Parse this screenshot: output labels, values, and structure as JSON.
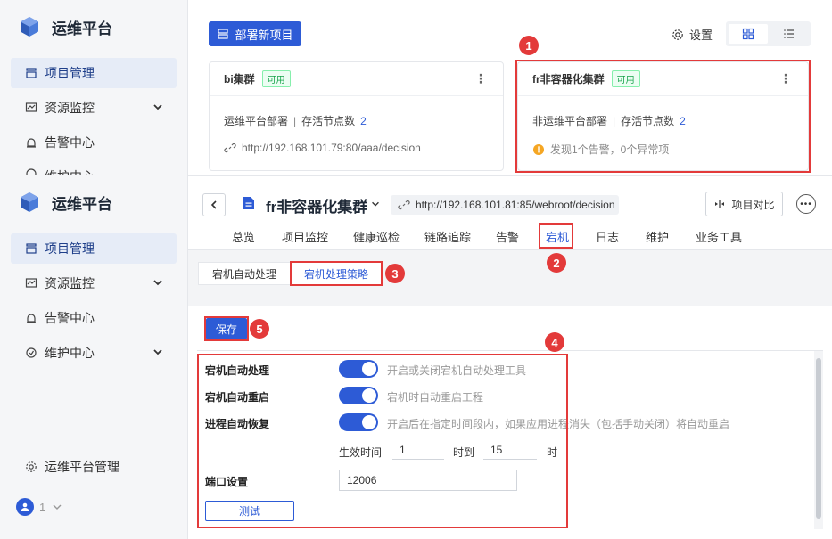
{
  "app": {
    "title": "运维平台"
  },
  "sidebar": {
    "items": [
      {
        "label": "项目管理"
      },
      {
        "label": "资源监控"
      },
      {
        "label": "告警中心"
      },
      {
        "label": "维护中心"
      }
    ],
    "clipped_label": "维护中心",
    "footer": {
      "admin_label": "运维平台管理",
      "user_count": "1"
    }
  },
  "toolbar": {
    "deploy_label": "部署新项目",
    "settings_label": "设置"
  },
  "cards": [
    {
      "name": "bi集群",
      "status": "可用",
      "deploy_type": "运维平台部署",
      "nodes_label": "存活节点数",
      "nodes": "2",
      "url": "http://192.168.101.79:80/aaa/decision"
    },
    {
      "name": "fr非容器化集群",
      "status": "可用",
      "deploy_type": "非运维平台部署",
      "nodes_label": "存活节点数",
      "nodes": "2",
      "alert": "发现1个告警，0个异常项"
    }
  ],
  "header": {
    "title": "fr非容器化集群",
    "url": "http://192.168.101.81:85/webroot/decision",
    "compare_label": "项目对比"
  },
  "tabs": [
    "总览",
    "项目监控",
    "健康巡检",
    "链路追踪",
    "告警",
    "宕机",
    "日志",
    "维护",
    "业务工具"
  ],
  "subtabs": [
    "宕机自动处理",
    "宕机处理策略"
  ],
  "save_label": "保存",
  "form": {
    "auto_handle": {
      "label": "宕机自动处理",
      "desc": "开启或关闭宕机自动处理工具",
      "on": true
    },
    "auto_restart": {
      "label": "宕机自动重启",
      "desc": "宕机时自动重启工程",
      "on": true
    },
    "auto_recover": {
      "label": "进程自动恢复",
      "desc": "开启后在指定时间段内，如果应用进程消失（包括手动关闭）将自动重启",
      "on": true
    },
    "effective_time_label": "生效时间",
    "from": "1",
    "to_label": "时到",
    "to": "15",
    "hour_label": "时",
    "port_label": "端口设置",
    "port": "12006",
    "test_label": "测试"
  },
  "markers": [
    "1",
    "2",
    "3",
    "4",
    "5"
  ],
  "colors": {
    "accent": "#2d5bd6",
    "annotation": "#e33a3a",
    "available": "#16a34a"
  }
}
